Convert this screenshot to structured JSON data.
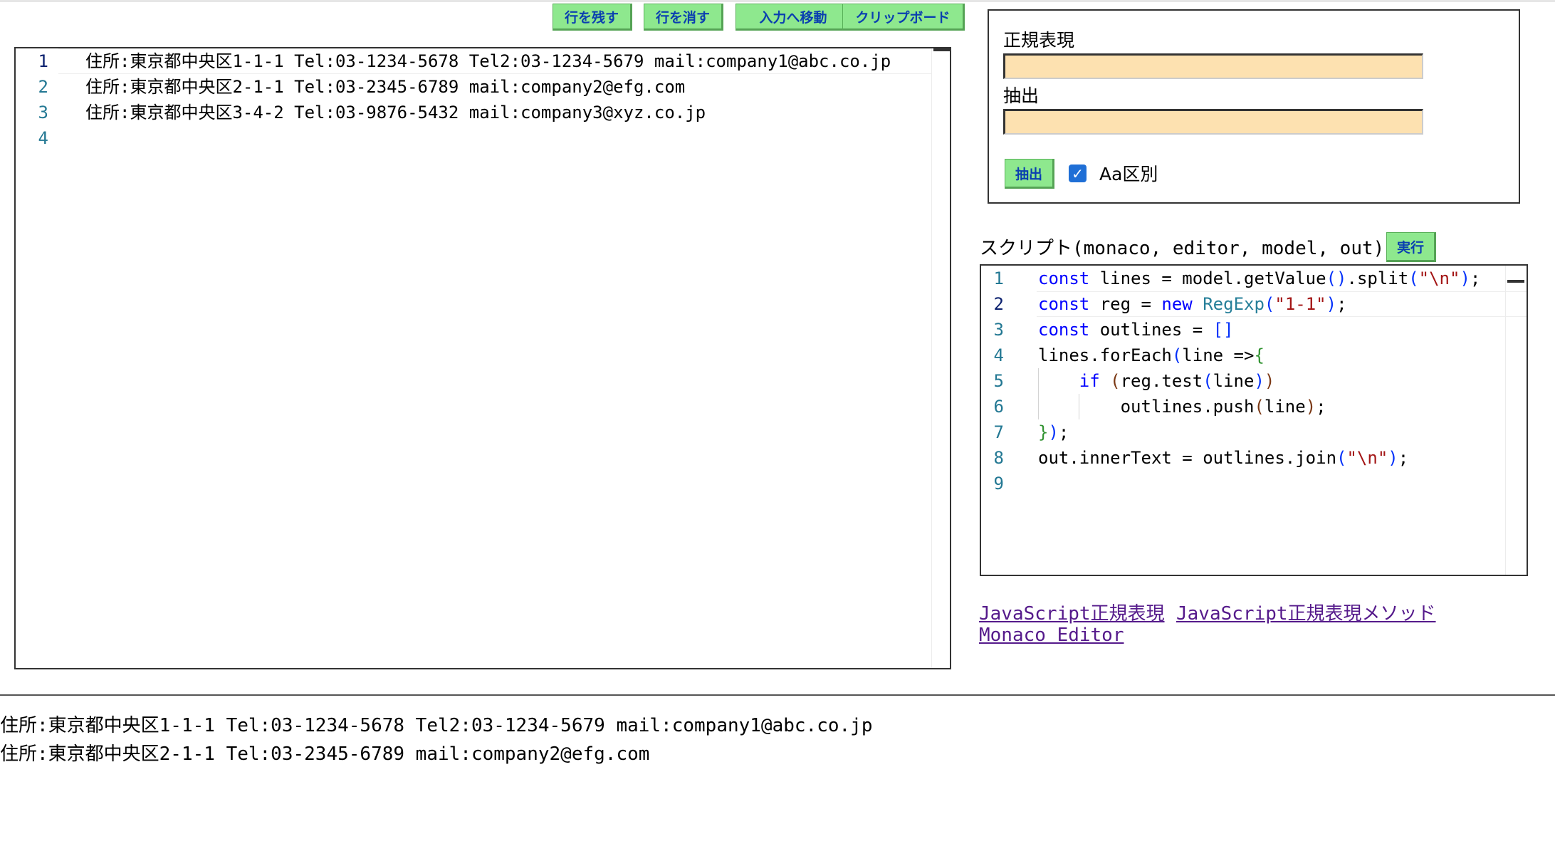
{
  "toolbar": {
    "keep_lines": "行を残す",
    "delete_lines": "行を消す",
    "move_to_input": "入力へ移動",
    "clipboard": "クリップボード"
  },
  "main_editor": {
    "lines": [
      {
        "num": "1",
        "text": "住所:東京都中央区1-1-1 Tel:03-1234-5678 Tel2:03-1234-5679 mail:company1@abc.co.jp"
      },
      {
        "num": "2",
        "text": "住所:東京都中央区2-1-1 Tel:03-2345-6789 mail:company2@efg.com"
      },
      {
        "num": "3",
        "text": "住所:東京都中央区3-4-2 Tel:03-9876-5432 mail:company3@xyz.co.jp"
      },
      {
        "num": "4",
        "text": ""
      }
    ]
  },
  "regex_panel": {
    "regex_label": "正規表現",
    "regex_value": "",
    "extract_label": "抽出",
    "extract_value": "",
    "extract_button": "抽出",
    "case_sensitive_label": "Aa区別",
    "case_sensitive_checked": true
  },
  "script": {
    "label": "スクリプト(monaco, editor, model, out)",
    "run_button": "実行",
    "line_numbers": [
      "1",
      "2",
      "3",
      "4",
      "5",
      "6",
      "7",
      "8",
      "9"
    ]
  },
  "links": {
    "js_regex": "JavaScript正規表現",
    "js_regex_methods": "JavaScript正規表現メソッド",
    "monaco": "Monaco Editor"
  },
  "output": {
    "lines": [
      "住所:東京都中央区1-1-1 Tel:03-1234-5678 Tel2:03-1234-5679 mail:company1@abc.co.jp",
      "住所:東京都中央区2-1-1 Tel:03-2345-6789 mail:company2@efg.com"
    ]
  },
  "colors": {
    "button_green": "#8ee88e",
    "input_bg": "#fde1b0",
    "line_number": "#237893",
    "keyword": "#0000ff",
    "string": "#a31515",
    "link": "#551a8b"
  }
}
